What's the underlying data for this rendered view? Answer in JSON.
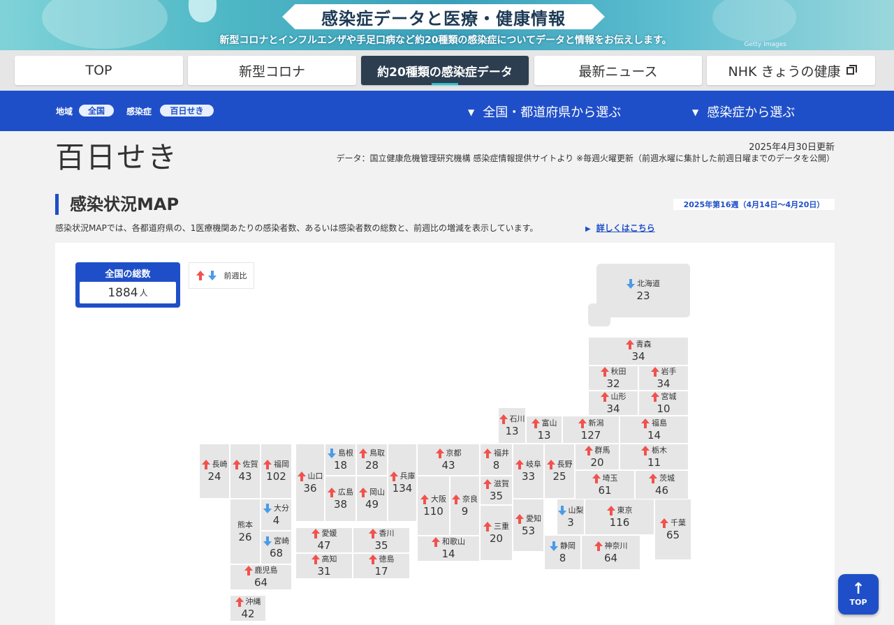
{
  "banner": {
    "title": "感染症データと医療・健康情報",
    "subtitle": "新型コロナとインフルエンザや手足口病など約20種類の感染症についてデータと情報をお伝えします。",
    "credit": "Getty Images"
  },
  "tabs": [
    {
      "label": "TOP",
      "active": false
    },
    {
      "label": "新型コロナ",
      "active": false
    },
    {
      "label": "約20種類の感染症データ",
      "active": true
    },
    {
      "label": "最新ニュース",
      "active": false
    },
    {
      "label": "NHK きょうの健康",
      "active": false
    }
  ],
  "filter": {
    "region_label": "地域",
    "region_value": "全国",
    "disease_label": "感染症",
    "disease_value": "百日せき",
    "select_region": "全国・都道府県から選ぶ",
    "select_disease": "感染症から選ぶ"
  },
  "page": {
    "title": "百日せき",
    "updated": "2025年4月30日更新",
    "source": "データ：国立健康危機管理研究機構 感染症情報提供サイトより ※毎週火曜更新（前週水曜に集計した前週日曜までのデータを公開）"
  },
  "section": {
    "title": "感染状況MAP",
    "week": "2025年第16週（4月14日～4月20日）",
    "description": "感染状況MAPでは、各都道府県の、1医療機関あたりの感染者数、あるいは感染者数の総数と、前週比の増減を表示しています。",
    "more_link": "詳しくはこちら"
  },
  "total": {
    "label": "全国の総数",
    "value": "1884",
    "unit": "人"
  },
  "legend": {
    "label": "前週比"
  },
  "colors": {
    "up": "#f0524d",
    "down": "#4a9be8",
    "primary": "#1f4fc8",
    "tile": "#e6e6e6"
  },
  "prefs": [
    {
      "name": "北海道",
      "value": "23",
      "trend": "down"
    },
    {
      "name": "青森",
      "value": "34",
      "trend": "up"
    },
    {
      "name": "秋田",
      "value": "32",
      "trend": "up"
    },
    {
      "name": "岩手",
      "value": "34",
      "trend": "up"
    },
    {
      "name": "山形",
      "value": "34",
      "trend": "up"
    },
    {
      "name": "宮城",
      "value": "10",
      "trend": "up"
    },
    {
      "name": "石川",
      "value": "13",
      "trend": "up"
    },
    {
      "name": "富山",
      "value": "13",
      "trend": "up"
    },
    {
      "name": "新潟",
      "value": "127",
      "trend": "up"
    },
    {
      "name": "福島",
      "value": "14",
      "trend": "up"
    },
    {
      "name": "長崎",
      "value": "24",
      "trend": "up"
    },
    {
      "name": "佐賀",
      "value": "43",
      "trend": "up"
    },
    {
      "name": "福岡",
      "value": "102",
      "trend": "up"
    },
    {
      "name": "山口",
      "value": "36",
      "trend": "up"
    },
    {
      "name": "島根",
      "value": "18",
      "trend": "down"
    },
    {
      "name": "鳥取",
      "value": "28",
      "trend": "up"
    },
    {
      "name": "兵庫",
      "value": "134",
      "trend": "up"
    },
    {
      "name": "京都",
      "value": "43",
      "trend": "up"
    },
    {
      "name": "福井",
      "value": "8",
      "trend": "up"
    },
    {
      "name": "岐阜",
      "value": "33",
      "trend": "up"
    },
    {
      "name": "長野",
      "value": "25",
      "trend": "up"
    },
    {
      "name": "群馬",
      "value": "20",
      "trend": "up"
    },
    {
      "name": "栃木",
      "value": "11",
      "trend": "up"
    },
    {
      "name": "茨城",
      "value": "46",
      "trend": "up"
    },
    {
      "name": "埼玉",
      "value": "61",
      "trend": "up"
    },
    {
      "name": "広島",
      "value": "38",
      "trend": "up"
    },
    {
      "name": "岡山",
      "value": "49",
      "trend": "up"
    },
    {
      "name": "大阪",
      "value": "110",
      "trend": "up"
    },
    {
      "name": "奈良",
      "value": "9",
      "trend": "up"
    },
    {
      "name": "滋賀",
      "value": "35",
      "trend": "up"
    },
    {
      "name": "大分",
      "value": "4",
      "trend": "down"
    },
    {
      "name": "熊本",
      "value": "26",
      "trend": "none"
    },
    {
      "name": "宮崎",
      "value": "68",
      "trend": "down"
    },
    {
      "name": "山梨",
      "value": "3",
      "trend": "down"
    },
    {
      "name": "東京",
      "value": "116",
      "trend": "up"
    },
    {
      "name": "愛媛",
      "value": "47",
      "trend": "up"
    },
    {
      "name": "香川",
      "value": "35",
      "trend": "up"
    },
    {
      "name": "三重",
      "value": "20",
      "trend": "up"
    },
    {
      "name": "愛知",
      "value": "53",
      "trend": "up"
    },
    {
      "name": "千葉",
      "value": "65",
      "trend": "up"
    },
    {
      "name": "和歌山",
      "value": "14",
      "trend": "up"
    },
    {
      "name": "静岡",
      "value": "8",
      "trend": "down"
    },
    {
      "name": "神奈川",
      "value": "64",
      "trend": "up"
    },
    {
      "name": "高知",
      "value": "31",
      "trend": "up"
    },
    {
      "name": "徳島",
      "value": "17",
      "trend": "up"
    },
    {
      "name": "鹿児島",
      "value": "64",
      "trend": "up"
    },
    {
      "name": "沖縄",
      "value": "42",
      "trend": "up"
    }
  ],
  "top_button": {
    "label": "TOP"
  }
}
